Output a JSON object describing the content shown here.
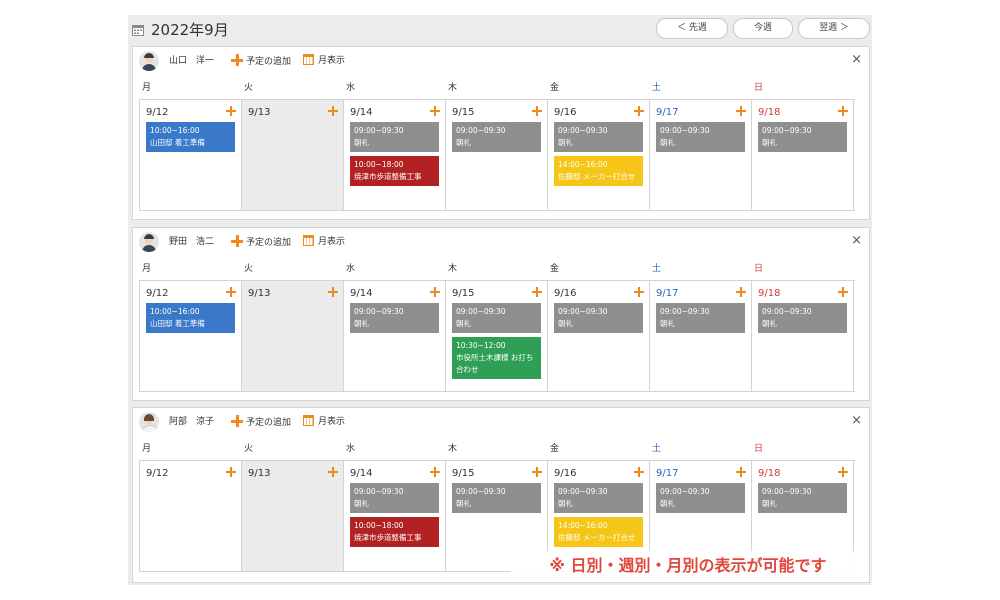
{
  "header": {
    "month_title": "2022年9月",
    "prev_label": "＜ 先週",
    "today_label": "今週",
    "next_label": "翌週 ＞"
  },
  "toolbar": {
    "add_label": "予定の追加",
    "month_view_label": "月表示",
    "close_label": "×"
  },
  "weekdays": [
    "月",
    "火",
    "水",
    "木",
    "金",
    "土",
    "日"
  ],
  "dates": [
    "9/12",
    "9/13",
    "9/14",
    "9/15",
    "9/16",
    "9/17",
    "9/18"
  ],
  "panels": [
    {
      "user": "山口　洋一",
      "events": [
        [
          {
            "time": "10:00~16:00",
            "title": "山田邸 着工準備",
            "color": "blue"
          }
        ],
        [],
        [
          {
            "time": "09:00~09:30",
            "title": "朝礼",
            "color": "gray"
          },
          {
            "time": "10:00~18:00",
            "title": "焼津市歩道整備工事",
            "color": "red"
          }
        ],
        [
          {
            "time": "09:00~09:30",
            "title": "朝礼",
            "color": "gray"
          }
        ],
        [
          {
            "time": "09:00~09:30",
            "title": "朝礼",
            "color": "gray"
          },
          {
            "time": "14:00~16:00",
            "title": "佐藤邸 メーカー打合せ",
            "color": "yellow"
          }
        ],
        [
          {
            "time": "09:00~09:30",
            "title": "朝礼",
            "color": "gray"
          }
        ],
        [
          {
            "time": "09:00~09:30",
            "title": "朝礼",
            "color": "gray"
          }
        ]
      ]
    },
    {
      "user": "野田　浩二",
      "events": [
        [
          {
            "time": "10:00~16:00",
            "title": "山田邸 着工準備",
            "color": "blue"
          }
        ],
        [],
        [
          {
            "time": "09:00~09:30",
            "title": "朝礼",
            "color": "gray"
          }
        ],
        [
          {
            "time": "09:00~09:30",
            "title": "朝礼",
            "color": "gray"
          },
          {
            "time": "10:30~12:00",
            "title": "市役所土木課様 お打ち合わせ",
            "color": "green"
          }
        ],
        [
          {
            "time": "09:00~09:30",
            "title": "朝礼",
            "color": "gray"
          }
        ],
        [
          {
            "time": "09:00~09:30",
            "title": "朝礼",
            "color": "gray"
          }
        ],
        [
          {
            "time": "09:00~09:30",
            "title": "朝礼",
            "color": "gray"
          }
        ]
      ]
    },
    {
      "user": "阿部　涼子",
      "events": [
        [],
        [],
        [
          {
            "time": "09:00~09:30",
            "title": "朝礼",
            "color": "gray"
          },
          {
            "time": "10:00~18:00",
            "title": "焼津市歩道整備工事",
            "color": "red"
          }
        ],
        [
          {
            "time": "09:00~09:30",
            "title": "朝礼",
            "color": "gray"
          }
        ],
        [
          {
            "time": "09:00~09:30",
            "title": "朝礼",
            "color": "gray"
          },
          {
            "time": "14:00~16:00",
            "title": "佐藤邸 メーカー打合せ",
            "color": "yellow"
          }
        ],
        [
          {
            "time": "09:00~09:30",
            "title": "朝礼",
            "color": "gray"
          }
        ],
        [
          {
            "time": "09:00~09:30",
            "title": "朝礼",
            "color": "gray"
          }
        ]
      ]
    }
  ],
  "note": "※ 日別・週別・月別の表示が可能です"
}
